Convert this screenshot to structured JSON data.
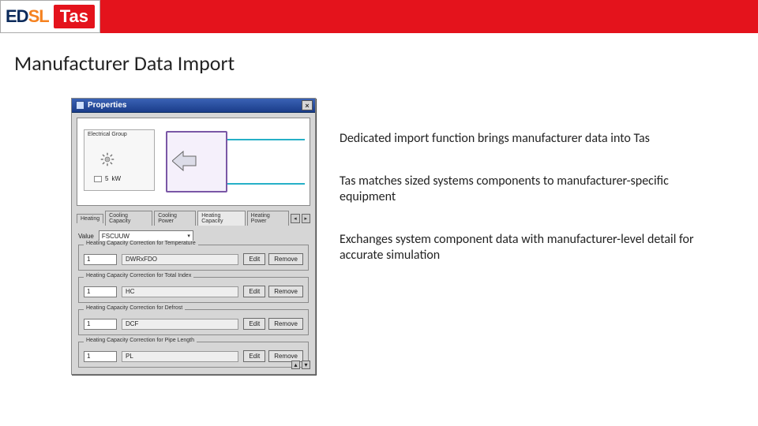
{
  "header": {
    "brand_ed": "ED",
    "brand_sl": "SL",
    "brand_tas": "Tas"
  },
  "page": {
    "title": "Manufacturer Data Import"
  },
  "bullets": {
    "b1": "Dedicated import function brings manufacturer data into Tas",
    "b2": "Tas matches sized systems components to manufacturer-specific equipment",
    "b3": "Exchanges system component data with manufacturer-level detail for accurate simulation"
  },
  "window": {
    "title": "Properties",
    "close_label": "×",
    "stage": {
      "group_label": "Electrical Group",
      "kw_label": "kW",
      "kw_value": "5"
    },
    "tabs": {
      "t1": "Heating",
      "t2": "Cooling Capacity",
      "t3": "Cooling Power",
      "t4": "Heating Capacity",
      "t5": "Heating Power",
      "scroll_left": "◂",
      "scroll_right": "▸"
    },
    "value_label": "Value",
    "value_dropdown": "FSCUUW",
    "groups": {
      "g1": {
        "legend": "Heating Capacity Correction for Temperature",
        "num": "1",
        "readout": "DWRxFDO",
        "edit": "Edit",
        "remove": "Remove"
      },
      "g2": {
        "legend": "Heating Capacity Correction for Total Index",
        "num": "1",
        "readout": "HC",
        "edit": "Edit",
        "remove": "Remove"
      },
      "g3": {
        "legend": "Heating Capacity Correction for Defrost",
        "num": "1",
        "readout": "DCF",
        "edit": "Edit",
        "remove": "Remove"
      },
      "g4": {
        "legend": "Heating Capacity Correction for Pipe Length",
        "num": "1",
        "readout": "PL",
        "edit": "Edit",
        "remove": "Remove"
      }
    },
    "scroll_up": "▴",
    "scroll_dn": "▾"
  }
}
